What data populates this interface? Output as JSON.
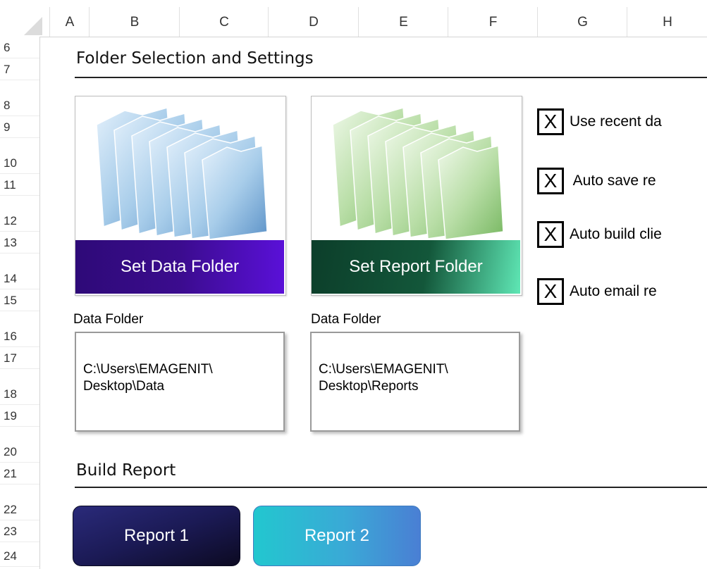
{
  "sheet": {
    "columns": [
      "A",
      "B",
      "C",
      "D",
      "E",
      "F",
      "G",
      "H"
    ],
    "rows": [
      "6",
      "7",
      "8",
      "9",
      "10",
      "11",
      "12",
      "13",
      "14",
      "15",
      "16",
      "17",
      "18",
      "19",
      "20",
      "21",
      "22",
      "23",
      "24"
    ]
  },
  "sections": {
    "folder_title": "Folder Selection and Settings",
    "build_title": "Build Report"
  },
  "folders": {
    "data_button": "Set Data Folder",
    "report_button": "Set Report Folder",
    "data_label": "Data Folder",
    "report_label": "Data Folder",
    "data_path_line1": "C:\\Users\\EMAGENIT\\",
    "data_path_line2": "Desktop\\Data",
    "report_path_line1": "C:\\Users\\EMAGENIT\\",
    "report_path_line2": "Desktop\\Reports"
  },
  "options": [
    {
      "mark": "X",
      "label": "Use recent da"
    },
    {
      "mark": "X",
      "label": " Auto save re"
    },
    {
      "mark": "X",
      "label": "Auto build clie"
    },
    {
      "mark": "X",
      "label": "Auto email re"
    }
  ],
  "reports": {
    "report1": "Report 1",
    "report2": "Report 2"
  },
  "colors": {
    "data_button": "#3b0c8e",
    "report_button": "#13573a",
    "report1": "#1b1a55",
    "report2": "#35b9d0"
  }
}
